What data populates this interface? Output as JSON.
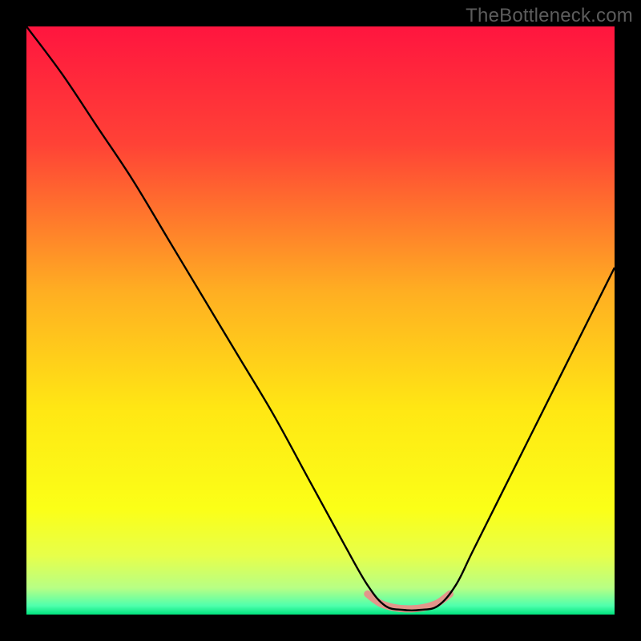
{
  "watermark": "TheBottleneck.com",
  "chart_data": {
    "type": "line",
    "title": "",
    "xlabel": "",
    "ylabel": "",
    "xlim": [
      0,
      100
    ],
    "ylim": [
      0,
      100
    ],
    "gradient_stops": [
      {
        "pos": 0.0,
        "color": "#ff153f"
      },
      {
        "pos": 0.2,
        "color": "#ff4236"
      },
      {
        "pos": 0.45,
        "color": "#ffae22"
      },
      {
        "pos": 0.65,
        "color": "#ffe714"
      },
      {
        "pos": 0.82,
        "color": "#fbff17"
      },
      {
        "pos": 0.9,
        "color": "#e7ff4a"
      },
      {
        "pos": 0.955,
        "color": "#b7ff85"
      },
      {
        "pos": 0.985,
        "color": "#4fffad"
      },
      {
        "pos": 1.0,
        "color": "#00e37e"
      }
    ],
    "series": [
      {
        "name": "bottleneck-curve",
        "x": [
          0,
          6,
          12,
          18,
          24,
          30,
          36,
          42,
          48,
          54,
          58,
          61,
          64,
          67,
          70,
          73,
          76,
          82,
          88,
          94,
          100
        ],
        "values": [
          100,
          92,
          83,
          74,
          64,
          54,
          44,
          34,
          23,
          12,
          5,
          1.5,
          0.8,
          0.8,
          1.5,
          5,
          11,
          23,
          35,
          47,
          59
        ]
      },
      {
        "name": "sweet-spot-band",
        "x": [
          58,
          60,
          62,
          64,
          66,
          68,
          70,
          72
        ],
        "values": [
          3.5,
          2.0,
          1.3,
          1.0,
          1.0,
          1.3,
          2.0,
          3.5
        ]
      }
    ],
    "sweet_spot_style": {
      "stroke": "#e2968b",
      "width": 9
    }
  }
}
